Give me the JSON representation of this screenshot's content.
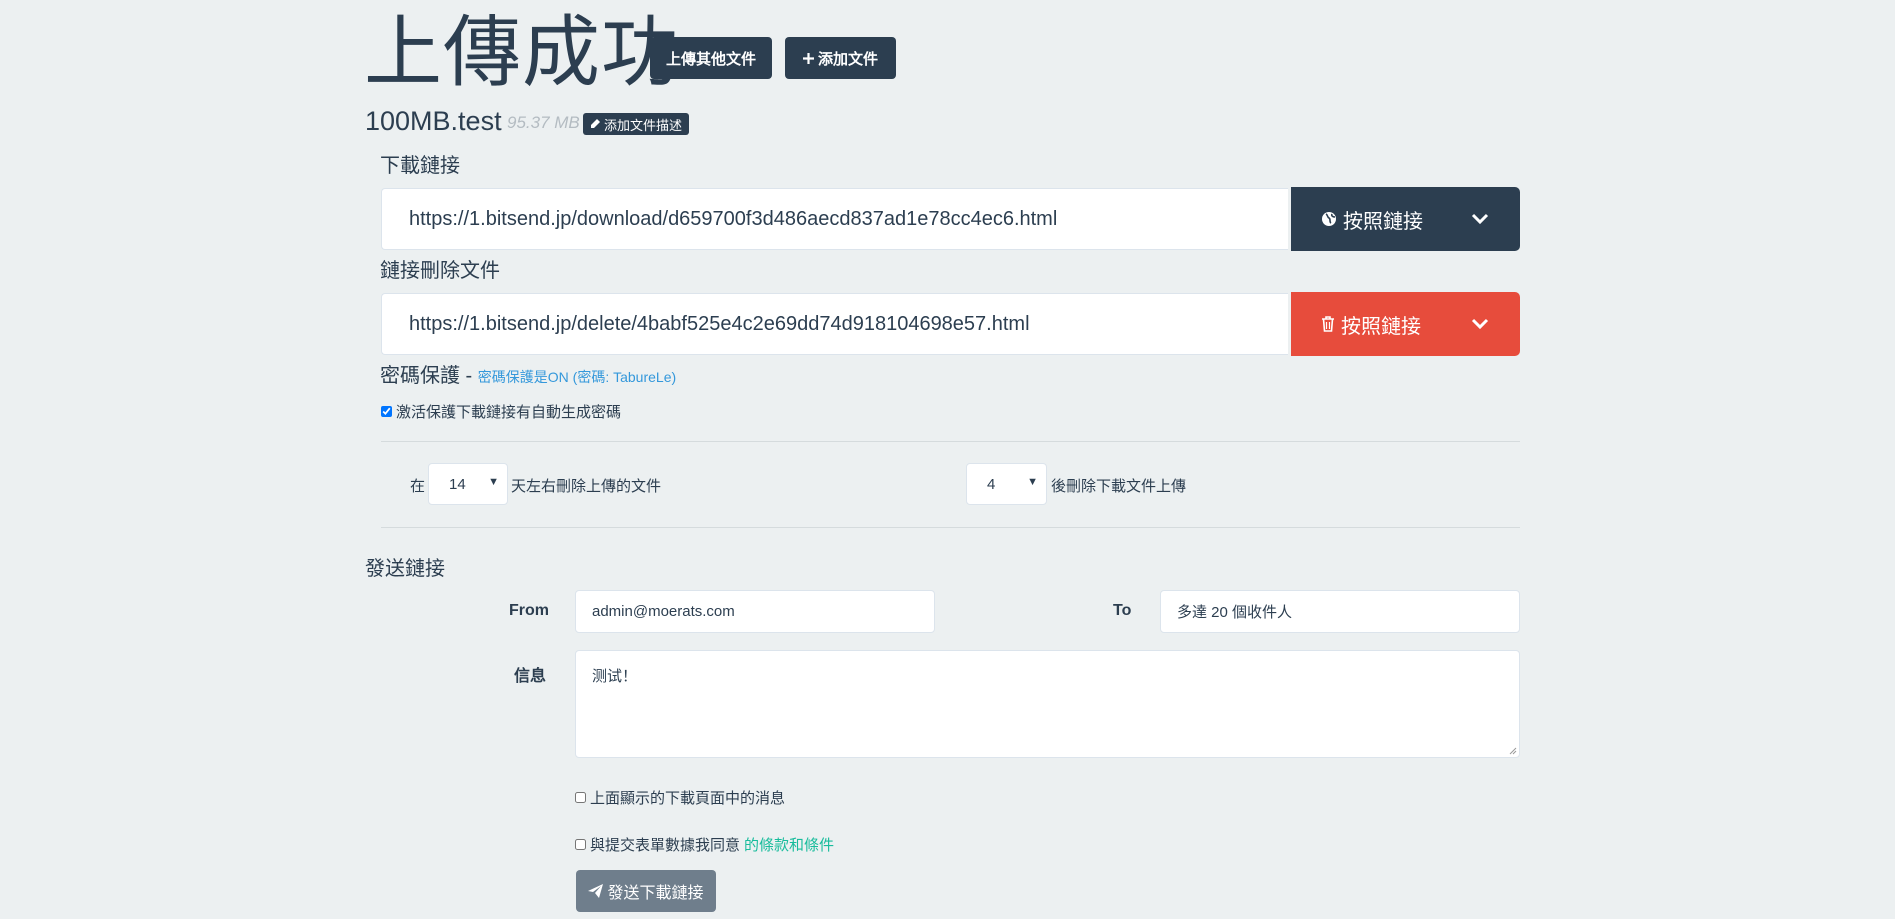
{
  "header": {
    "title": "上傳成功",
    "upload_other_label": "上傳其他文件",
    "add_file_label": "添加文件"
  },
  "file": {
    "name": "100MB.test",
    "size": "95.37 MB",
    "add_description_label": "添加文件描述"
  },
  "download": {
    "label": "下載鏈接",
    "url": "https://1.bitsend.jp/download/d659700f3d486aecd837ad1e78cc4ec6.html",
    "copy_label": "按照鏈接"
  },
  "delete": {
    "label": "鏈接刪除文件",
    "url": "https://1.bitsend.jp/delete/4babf525e4c2e69dd74d918104698e57.html",
    "copy_label": "按照鏈接"
  },
  "password": {
    "label": "密碼保護",
    "separator": " - ",
    "status": "密碼保護是ON (密碼: TabureLe)",
    "auto_generate_label": "激活保護下載鏈接有自動生成密碼",
    "auto_generate_checked": true
  },
  "expiry": {
    "prefix": "在",
    "days_value": "14",
    "days_suffix": "天左右刪除上傳的文件",
    "downloads_value": "4",
    "downloads_suffix": "後刪除下載文件上傳"
  },
  "send": {
    "heading": "發送鏈接",
    "from_label": "From",
    "from_value": "admin@moerats.com",
    "to_label": "To",
    "to_placeholder": "多達 20 個收件人",
    "message_label": "信息",
    "message_value": "测试！",
    "show_message_label": "上面顯示的下載頁面中的消息",
    "agree_prefix": "與提交表單數據我同意",
    "agree_link": "的條款和條件",
    "submit_label": "發送下載鏈接"
  },
  "colors": {
    "primary": "#2c3e50",
    "danger": "#e74c3c",
    "info": "#3498db",
    "success": "#18bc9c",
    "background": "#ecf0f1"
  }
}
